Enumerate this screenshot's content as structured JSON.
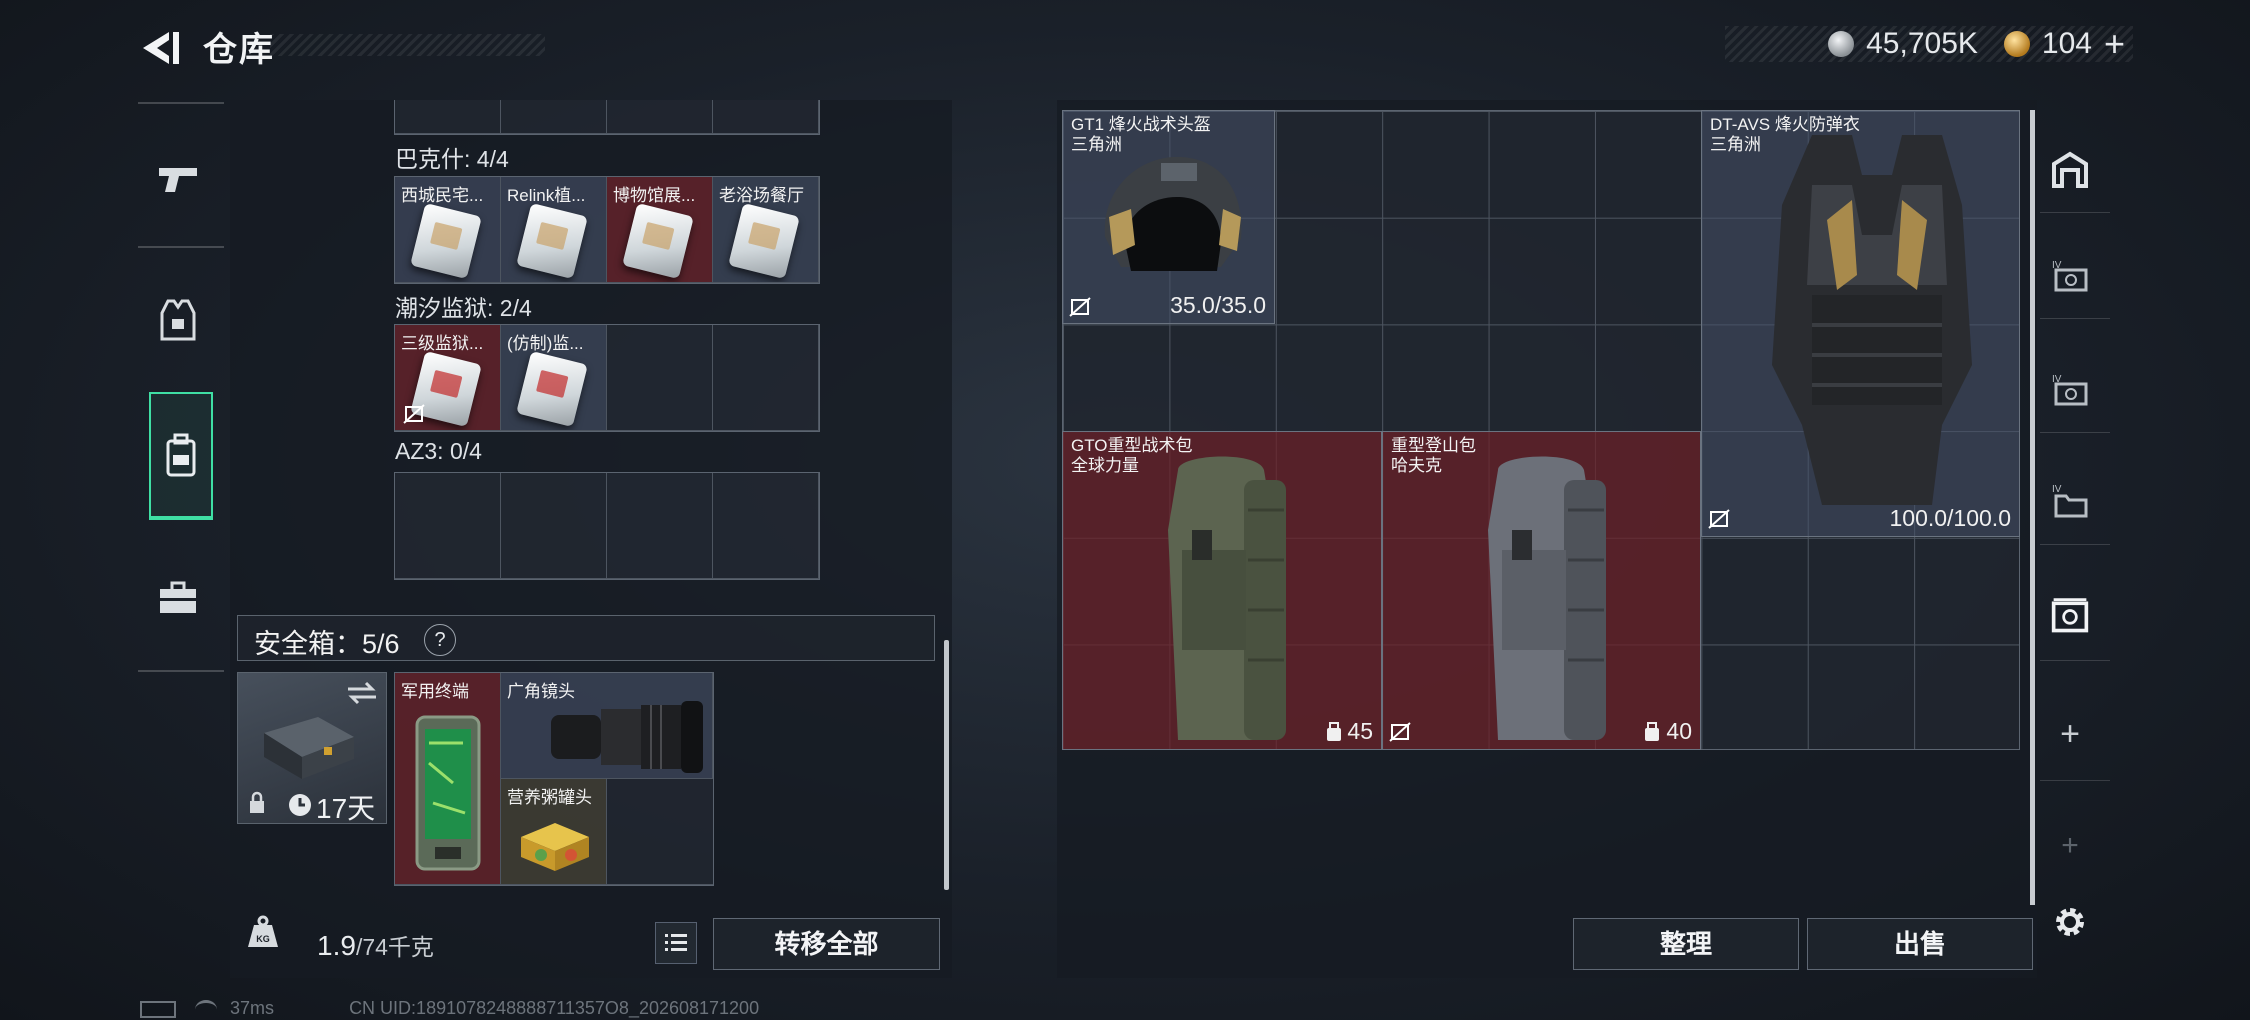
{
  "header": {
    "title": "仓库",
    "currency_silver": "45,705K",
    "currency_gold": "104",
    "plus": "+"
  },
  "left": {
    "groups": [
      {
        "label": "巴克什: 4/4",
        "items": [
          "西城民宅...",
          "Relink植...",
          "博物馆展...",
          "老浴场餐厅"
        ]
      },
      {
        "label": "潮汐监狱: 2/4",
        "items": [
          "三级监狱...",
          "(仿制)监..."
        ]
      },
      {
        "label": "AZ3: 0/4",
        "items": []
      }
    ],
    "safebox": {
      "label": "安全箱：5/6",
      "help": "?",
      "timer": "17天",
      "items": [
        "军用终端",
        "广角镜头",
        "营养粥罐头"
      ]
    },
    "weight": {
      "value": "1.9",
      "unit": "/74千克"
    },
    "transfer_label": "转移全部"
  },
  "right": {
    "helmet": {
      "name": "GT1 烽火战术头盔",
      "region": "三角洲",
      "durability": "35.0/35.0"
    },
    "armor": {
      "name": "DT-AVS 烽火防弹衣",
      "region": "三角洲",
      "durability": "100.0/100.0"
    },
    "backpack1": {
      "name": "GTO重型战术包",
      "brand": "全球力量",
      "capacity": "45"
    },
    "backpack2": {
      "name": "重型登山包",
      "brand": "哈夫克",
      "capacity": "40"
    },
    "sort_label": "整理",
    "sell_label": "出售",
    "sidebar": {
      "add1": "+",
      "add2": "+"
    }
  },
  "status": {
    "ping": "37ms",
    "uid": "CN UID:1891078248888711357O8_202608171200"
  },
  "colors": {
    "accent_green": "#3fdfa4",
    "red_cell": "#6e2026",
    "blue_cell": "#465068"
  }
}
